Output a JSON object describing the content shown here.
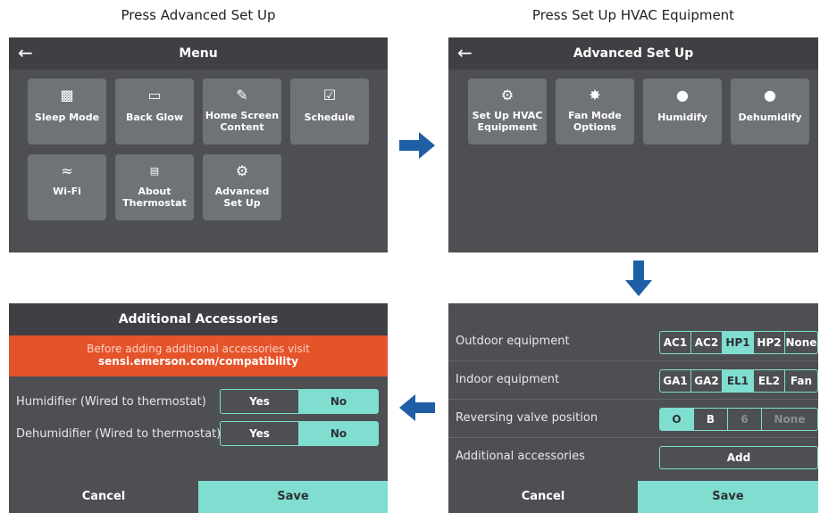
{
  "captions": {
    "top_left": "Press Advanced Set Up",
    "top_right": "Press Set Up HVAC Equipment"
  },
  "menu": {
    "title": "Menu",
    "back_icon": "left-arrow-icon",
    "tiles": [
      {
        "label": "Sleep Mode",
        "icon": "sleep-icon",
        "glyph": "zᴬ"
      },
      {
        "label": "Back Glow",
        "icon": "backglow-icon",
        "glyph": "▭"
      },
      {
        "label": "Home Screen Content",
        "icon": "edit-icon",
        "glyph": "✎"
      },
      {
        "label": "Schedule",
        "icon": "calendar-icon",
        "glyph": "☑"
      },
      {
        "label": "Wi-Fi",
        "icon": "wifi-icon",
        "glyph": "◠"
      },
      {
        "label": "About Thermostat",
        "icon": "thermostat-icon",
        "glyph": "72°"
      },
      {
        "label": "Advanced Set Up",
        "icon": "gear-icon",
        "glyph": "⚙"
      }
    ]
  },
  "advanced": {
    "title": "Advanced Set Up",
    "tiles": [
      {
        "label": "Set Up HVAC Equipment",
        "icon": "gear-icon",
        "glyph": "⚙"
      },
      {
        "label": "Fan Mode Options",
        "icon": "fan-icon",
        "glyph": "✤"
      },
      {
        "label": "Humidify",
        "icon": "droplet-plus-icon",
        "glyph": "+"
      },
      {
        "label": "Dehumidify",
        "icon": "droplet-minus-icon",
        "glyph": "−"
      }
    ]
  },
  "hvac": {
    "rows": [
      {
        "label": "Outdoor equipment",
        "options": [
          "AC1",
          "AC2",
          "HP1",
          "HP2",
          "None"
        ],
        "selected": "HP1"
      },
      {
        "label": "Indoor equipment",
        "options": [
          "GA1",
          "GA2",
          "EL1",
          "EL2",
          "Fan"
        ],
        "selected": "EL1"
      },
      {
        "label": "Reversing valve position",
        "options": [
          "O",
          "B",
          "6",
          "None"
        ],
        "selected": "O"
      },
      {
        "label": "Additional accessories",
        "button": "Add"
      }
    ],
    "cancel": "Cancel",
    "save": "Save"
  },
  "accessories": {
    "title": "Additional Accessories",
    "banner_line1": "Before adding additional accessories visit",
    "banner_line2": "sensi.emerson.com/compatibility",
    "rows": [
      {
        "label": "Humidifier (Wired to thermostat)",
        "yes": "Yes",
        "no": "No",
        "selected": "No"
      },
      {
        "label": "Dehumidifier (Wired to thermostat)",
        "yes": "Yes",
        "no": "No",
        "selected": "No"
      }
    ],
    "cancel": "Cancel",
    "save": "Save"
  },
  "colors": {
    "accent": "#7fded0",
    "panel_bg": "#4d4f53",
    "tile_bg": "#6f7277",
    "banner": "#e5532a",
    "flow_arrow": "#1f5fa6"
  }
}
